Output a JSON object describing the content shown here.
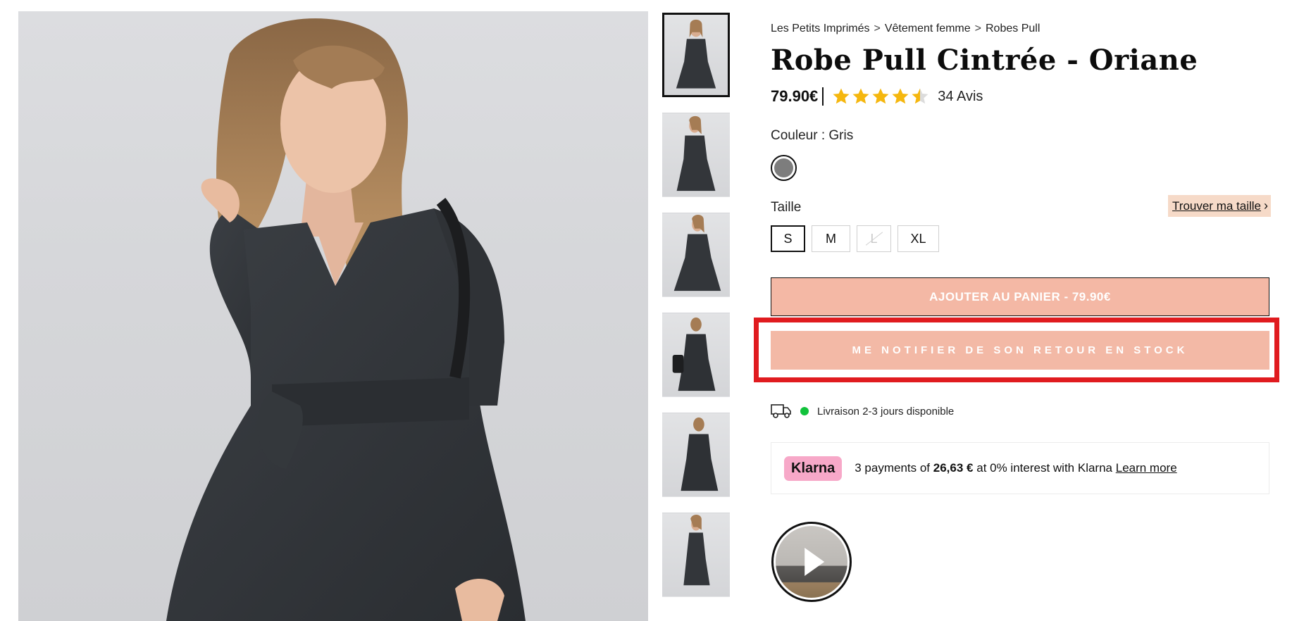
{
  "breadcrumb": {
    "items": [
      "Les Petits Imprimés",
      "Vêtement femme",
      "Robes Pull"
    ],
    "separator": ">"
  },
  "product": {
    "title": "Robe Pull Cintrée - Oriane",
    "price": "79.90€",
    "rating": 4.5,
    "reviews": "34 Avis",
    "color_label": "Couleur : Gris",
    "color_swatch": "#7d7d7d",
    "size_label": "Taille",
    "size_guide": "Trouver ma taille",
    "sizes": [
      {
        "label": "S",
        "state": "selected"
      },
      {
        "label": "M",
        "state": "available"
      },
      {
        "label": "L",
        "state": "unavailable"
      },
      {
        "label": "XL",
        "state": "available"
      }
    ]
  },
  "actions": {
    "add_to_cart": "AJOUTER AU PANIER -  79.90€",
    "notify": "ME NOTIFIER DE SON RETOUR EN STOCK"
  },
  "delivery": {
    "text": "Livraison 2-3 jours disponible"
  },
  "klarna": {
    "logo": "Klarna",
    "text_before": "3 payments of",
    "amount": "26,63 €",
    "text_after": "at 0% interest with Klarna",
    "learn_more": "Learn more"
  },
  "gallery": {
    "thumb_count": 6
  },
  "colors": {
    "button_pink": "#f4b8a5",
    "highlight_red": "#e01b1f",
    "star_gold": "#f5b70f",
    "stock_green": "#11c23b",
    "klarna_pink": "#f7a8c8"
  }
}
